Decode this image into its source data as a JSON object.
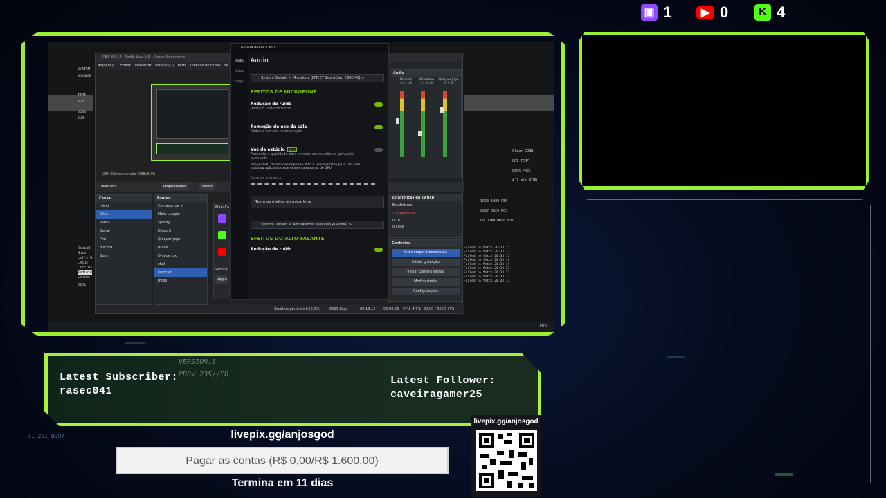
{
  "top_stats": [
    {
      "platform": "twitch",
      "icon": "twitch-icon",
      "count": "1",
      "color": "#9146ff"
    },
    {
      "platform": "youtube",
      "icon": "youtube-icon",
      "count": "0",
      "color": "#ff0000"
    },
    {
      "platform": "kick",
      "icon": "kick-icon",
      "count": "4",
      "color": "#53fc18"
    }
  ],
  "obs": {
    "title": "OBS 32.0.4 - Perfil: Live 1.0 - Cenas: Sem nome",
    "menu": [
      "Arquivo (F)",
      "Editar",
      "Visualizar",
      "Painéis (D)",
      "Perfil",
      "Coleção de cenas",
      "Fe"
    ],
    "current_scene": "webcam",
    "source_tabs": [
      "Propriedades",
      "Filtros"
    ],
    "scenes_title": "Cenas",
    "scenes": [
      "Inicio",
      "Chat",
      "Pausa",
      "Game",
      "Pim",
      "discord",
      "Sons"
    ],
    "selected_scene": "Chat",
    "sources_title": "Fontes",
    "sources": [
      "Contador de vi",
      "Meta Livepix",
      "Spotify",
      "Discord",
      "Quiquer jogo",
      "Brave",
      "Qrcode pix",
      "chat",
      "webcam",
      "moss"
    ],
    "selected_source": "webcam",
    "audio_title": "Áudio",
    "audio_channels": [
      {
        "name": "Discord",
        "db": "-41,2 dB"
      },
      {
        "name": "Microfone",
        "db": "-22,8 dB"
      },
      {
        "name": "Quiquer jogo",
        "db": "-4,7 dB"
      }
    ],
    "stats_title": "Estatísticas da Twitch",
    "stats_sub": "Estatísticas",
    "stats": [
      "1 espectador",
      "0:16",
      "0 clipe"
    ],
    "controls_title": "Controles",
    "controls": [
      "Interromper transmissão",
      "Iniciar gravação",
      "Iniciar câmera virtual",
      "Modo estúdio",
      "Configurações"
    ],
    "status": {
      "frames": "Quadros perdidos 0 (0,0%)",
      "kbps": "8525 kbps",
      "time": "00:19:12",
      "rec": "00:00:00",
      "cpu": "CPU: 4,9%",
      "fps": "60,00 / 60,00 FPS"
    },
    "main_chat_label": "Main Ca",
    "vertical_label": "Vertical",
    "upgrade_label": "Upgra",
    "zoom": "28%",
    "dimensions": "Dimensionado (938x504)"
  },
  "nvidia": {
    "title": "NVIDIA BROADCAST",
    "side": [
      "Áudio",
      "Vídeo",
      "Configu..."
    ],
    "heading": "Áudio",
    "mic_device": "System Default < Microfone (EMEET SmartCam C60E 4K) >",
    "mic_section": "EFEITOS DE MICROFONE",
    "effects": [
      {
        "name": "Redução de ruído",
        "desc": "Reduz o ruído de fundo",
        "on": true
      },
      {
        "name": "Remoção de eco da sala",
        "desc": "Reduz o som de reverberação",
        "on": true
      },
      {
        "name": "Voz de estúdio",
        "desc": "Aumenta a qualidade para simular um estúdio de gravação avançado",
        "on": false
      }
    ],
    "beta": "Beta",
    "gpu_note": "Requer GPU de alto desempenho. Não é recomendado para uso com jogos ou aplicativos que exigem alta carga de GPU.",
    "mic_output": "Saída do microfone",
    "test_effects": "Teste os efeitos do microfone",
    "spk_device": "System Default < Alto-falantes (Realtek(R) Audio) >",
    "spk_section": "EFEITOS DO ALTO-FALANTE",
    "spk_effect": "Redução de ruído"
  },
  "terminal": {
    "left": [
      "SYSTEM",
      "WELLNMOR",
      "TIME",
      "MON",
      "085%",
      "SUN"
    ],
    "left_list": [
      "Rewind",
      "Nova",
      "Let's G",
      "Cetus",
      "Circles",
      "Radiate",
      "Lensko",
      "020%"
    ],
    "right_top": [
      "Clear",
      "CONN",
      "001",
      "TEMP",
      "086%",
      "PREC",
      "4.7 m/s",
      "WIND"
    ],
    "right_mid": [
      "1920",
      "1080",
      "RES",
      "0857",
      "0824",
      "POS",
      "UP",
      "DOWN",
      "MOVE",
      "EVT"
    ],
    "log": [
      "Failed to fetch 20:33:15",
      "Failed to fetch 20:33:17",
      "Failed to fetch 20:33:17",
      "Failed to fetch 20:33:19",
      "Failed to fetch 20:33:19",
      "Failed to fetch 20:33:21",
      "Failed to fetch 20:33:21",
      "Failed to fetch 20:33:23",
      "Failed to fetch 20:33:23"
    ],
    "taskbar_lang": "POR"
  },
  "banner": {
    "version": "VERSION.3",
    "prov": "PROV 235//PD",
    "sub_label": "Latest Subscriber:",
    "sub_name": "rasec041",
    "follow_label": "Latest Follower:",
    "follow_name": "caveiragamer25"
  },
  "goal": {
    "url": "livepix.gg/anjosgod",
    "text": "Pagar as contas (R$ 0,00/R$ 1.600,00)",
    "progress": 0,
    "ends": "Termina em 11 dias"
  },
  "qr": {
    "label": "livepix.gg/anjosgod"
  },
  "deco_number": "31 291 8097",
  "colors": {
    "frame": "#9cf032",
    "nvidia_green": "#76b900",
    "obs_select": "#2f5fb3"
  }
}
